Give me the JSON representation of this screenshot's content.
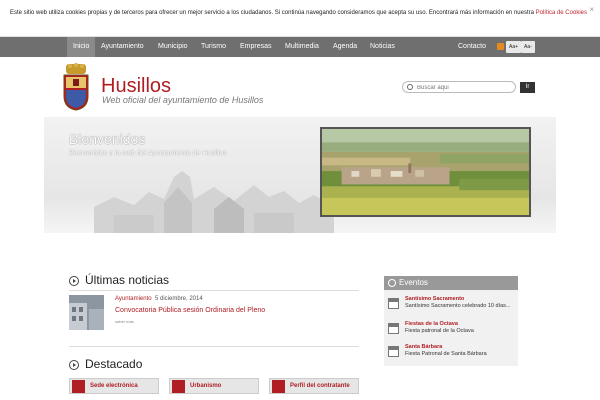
{
  "cookie": {
    "text": "Este sitio web utiliza cookies propias y de terceros para ofrecer un mejor servicio a los ciudadanos. Si continúa navegando consideramos que acepta su uso. Encontrará más información en nuestra ",
    "link": "Política de Cookies",
    "close": "×"
  },
  "nav": {
    "items": [
      "Inicio",
      "Ayuntamiento",
      "Municipio",
      "Turismo",
      "Empresas",
      "Multimedia",
      "Agenda",
      "Noticias"
    ],
    "contact": "Contacto",
    "font_larger": "Aa+",
    "font_smaller": "Aa-"
  },
  "header": {
    "title": "Husillos",
    "subtitle": "Web oficial del ayuntamiento de Husillos",
    "search_placeholder": "Buscar aqui",
    "search_button": "Ir"
  },
  "banner": {
    "title": "Bienvenidos",
    "subtitle": "Bienvenidos a la web del Ayuntamiento de Husillos"
  },
  "news": {
    "heading": "Últimas noticias",
    "items": [
      {
        "category": "Ayuntamiento",
        "date": "5 diciembre, 2014",
        "title": "Convocatoria Pública sesión Ordinaria del Pleno",
        "more": "saber más"
      }
    ]
  },
  "featured": {
    "heading": "Destacado",
    "items": [
      "Sede electrónica",
      "Urbanismo",
      "Perfil del contratante"
    ]
  },
  "events": {
    "heading": "Eventos",
    "items": [
      {
        "title": "Santísimo Sacramento",
        "desc": "Santísimo Sacramento celebrado 10 días..."
      },
      {
        "title": "Fiestas de la Octava",
        "desc": "Fiesta patronal de la Octava"
      },
      {
        "title": "Santa Bárbara",
        "desc": "Fiesta Patronal de Santa Bárbara"
      }
    ]
  },
  "colors": {
    "brand_red": "#b01e23",
    "nav_bg": "#6f6f6f"
  }
}
